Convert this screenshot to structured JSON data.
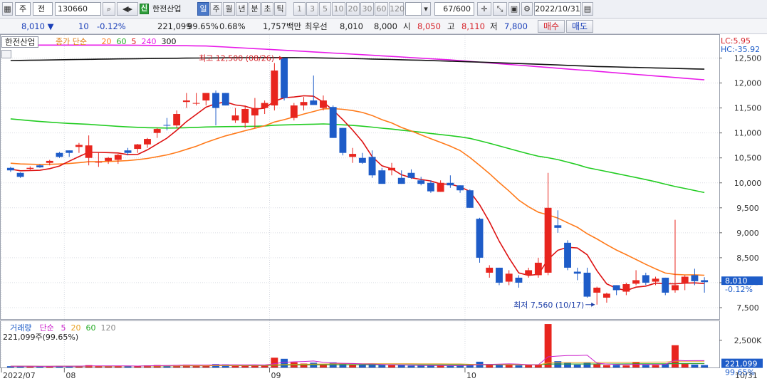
{
  "toolbar": {
    "market": "주",
    "period_select": "전",
    "code": "130660",
    "company": "한전산업",
    "periods": [
      "일",
      "주",
      "월",
      "년",
      "분",
      "초",
      "틱"
    ],
    "active_period": "일",
    "intervals": [
      "1",
      "3",
      "5",
      "10",
      "20",
      "30",
      "60",
      "120"
    ],
    "count": "67/600",
    "date": "2022/10/31"
  },
  "quote": {
    "price": "8,010",
    "change": "10",
    "change_pct": "-0.12%",
    "volume": "221,099",
    "vol_ratio": "99.65%",
    "turnover": "0.68%",
    "amount": "1,757백만",
    "best_label": "최우선",
    "best_ask": "8,010",
    "best_bid": "8,000",
    "open_label": "시",
    "open": "8,050",
    "high_label": "고",
    "high": "8,110",
    "low_label": "저",
    "low": "7,800",
    "buy": "매수",
    "sell": "매도"
  },
  "legend": {
    "name": "한전산업",
    "ma_label": "종가 단순",
    "ma20": "20",
    "ma60": "60",
    "ma5": "5",
    "ma240": "240",
    "ma300": "300",
    "vol_label": "거래량",
    "vol_ma_label": "단순",
    "vol_ma5": "5",
    "vol_ma20": "20",
    "vol_ma60": "60",
    "vol_ma120": "120",
    "vol_value": "221,099주(99.65%)"
  },
  "annotations": {
    "high": "최고 12,500 (08/26)",
    "low": "최저 7,560 (10/17)",
    "lc": "LC:5.95",
    "hc": "HC:-35.92"
  },
  "chart_data": {
    "type": "candlestick",
    "price_ticks": [
      "7,500",
      "8,000",
      "8,500",
      "9,000",
      "9,500",
      "10,000",
      "10,500",
      "11,000",
      "11,500",
      "12,000",
      "12,500"
    ],
    "price_tick_values": [
      7500,
      8000,
      8500,
      9000,
      9500,
      10000,
      10500,
      11000,
      11500,
      12000,
      12500
    ],
    "price_ylim": [
      7300,
      12750
    ],
    "current_price": "8,010",
    "current_pct": "-0.12%",
    "vol_ticks": [
      "2,500K"
    ],
    "vol_tick_values": [
      2500
    ],
    "vol_current": "221,099",
    "vol_current_pct": "99.65%",
    "vol_ylim": [
      0,
      4200
    ],
    "x_labels": [
      "2022/07",
      "08",
      "09",
      "10"
    ],
    "x_label_index": [
      0,
      6,
      27,
      47
    ],
    "end_label": "10/31",
    "candles": [
      {
        "o": 10300,
        "h": 10320,
        "l": 10220,
        "c": 10250,
        "v": 120
      },
      {
        "o": 10200,
        "h": 10210,
        "l": 10100,
        "c": 10120,
        "v": 110
      },
      {
        "o": 10280,
        "h": 10330,
        "l": 10240,
        "c": 10300,
        "v": 100
      },
      {
        "o": 10350,
        "h": 10370,
        "l": 10300,
        "c": 10310,
        "v": 95
      },
      {
        "o": 10400,
        "h": 10460,
        "l": 10350,
        "c": 10440,
        "v": 110
      },
      {
        "o": 10600,
        "h": 10620,
        "l": 10500,
        "c": 10520,
        "v": 140
      },
      {
        "o": 10650,
        "h": 10650,
        "l": 10520,
        "c": 10600,
        "v": 130
      },
      {
        "o": 10720,
        "h": 10800,
        "l": 10600,
        "c": 10760,
        "v": 150
      },
      {
        "o": 10500,
        "h": 10950,
        "l": 10350,
        "c": 10750,
        "v": 210
      },
      {
        "o": 10420,
        "h": 10600,
        "l": 10320,
        "c": 10420,
        "v": 130
      },
      {
        "o": 10440,
        "h": 10520,
        "l": 10380,
        "c": 10500,
        "v": 100
      },
      {
        "o": 10460,
        "h": 10580,
        "l": 10380,
        "c": 10560,
        "v": 160
      },
      {
        "o": 10650,
        "h": 10700,
        "l": 10550,
        "c": 10600,
        "v": 130
      },
      {
        "o": 10680,
        "h": 10780,
        "l": 10600,
        "c": 10770,
        "v": 150
      },
      {
        "o": 10770,
        "h": 10900,
        "l": 10700,
        "c": 10880,
        "v": 190
      },
      {
        "o": 11000,
        "h": 11100,
        "l": 10900,
        "c": 11080,
        "v": 220
      },
      {
        "o": 11160,
        "h": 11300,
        "l": 11050,
        "c": 11150,
        "v": 200
      },
      {
        "o": 11150,
        "h": 11450,
        "l": 11100,
        "c": 11380,
        "v": 230
      },
      {
        "o": 11620,
        "h": 11800,
        "l": 11500,
        "c": 11650,
        "v": 260
      },
      {
        "o": 11600,
        "h": 11800,
        "l": 11550,
        "c": 11600,
        "v": 220
      },
      {
        "o": 11650,
        "h": 11750,
        "l": 11550,
        "c": 11800,
        "v": 190
      },
      {
        "o": 11800,
        "h": 11850,
        "l": 11150,
        "c": 11500,
        "v": 310
      },
      {
        "o": 11800,
        "h": 11800,
        "l": 11550,
        "c": 11550,
        "v": 280
      },
      {
        "o": 11250,
        "h": 11500,
        "l": 11200,
        "c": 11350,
        "v": 200
      },
      {
        "o": 11200,
        "h": 11550,
        "l": 11100,
        "c": 11480,
        "v": 210
      },
      {
        "o": 11350,
        "h": 11700,
        "l": 11100,
        "c": 11500,
        "v": 240
      },
      {
        "o": 11500,
        "h": 11650,
        "l": 11380,
        "c": 11600,
        "v": 220
      },
      {
        "o": 11550,
        "h": 12400,
        "l": 11450,
        "c": 12250,
        "v": 900
      },
      {
        "o": 12500,
        "h": 12500,
        "l": 11650,
        "c": 11700,
        "v": 800
      },
      {
        "o": 11300,
        "h": 11600,
        "l": 11250,
        "c": 11550,
        "v": 480
      },
      {
        "o": 11550,
        "h": 11720,
        "l": 11450,
        "c": 11620,
        "v": 360
      },
      {
        "o": 11650,
        "h": 12150,
        "l": 11600,
        "c": 11560,
        "v": 440
      },
      {
        "o": 11500,
        "h": 11750,
        "l": 11450,
        "c": 11650,
        "v": 300
      },
      {
        "o": 11520,
        "h": 11550,
        "l": 10900,
        "c": 10900,
        "v": 470
      },
      {
        "o": 11100,
        "h": 11100,
        "l": 10550,
        "c": 10600,
        "v": 380
      },
      {
        "o": 10520,
        "h": 10700,
        "l": 10400,
        "c": 10580,
        "v": 240
      },
      {
        "o": 10500,
        "h": 10600,
        "l": 10380,
        "c": 10400,
        "v": 250
      },
      {
        "o": 10520,
        "h": 10650,
        "l": 10100,
        "c": 10150,
        "v": 280
      },
      {
        "o": 10250,
        "h": 10300,
        "l": 9980,
        "c": 9980,
        "v": 220
      },
      {
        "o": 10250,
        "h": 10400,
        "l": 10150,
        "c": 10300,
        "v": 210
      },
      {
        "o": 10100,
        "h": 10250,
        "l": 9980,
        "c": 9980,
        "v": 200
      },
      {
        "o": 10200,
        "h": 10270,
        "l": 10080,
        "c": 10100,
        "v": 170
      },
      {
        "o": 10050,
        "h": 10120,
        "l": 9950,
        "c": 9980,
        "v": 160
      },
      {
        "o": 10000,
        "h": 10050,
        "l": 9800,
        "c": 9830,
        "v": 180
      },
      {
        "o": 9820,
        "h": 10050,
        "l": 9820,
        "c": 10000,
        "v": 190
      },
      {
        "o": 10000,
        "h": 10150,
        "l": 9900,
        "c": 9950,
        "v": 150
      },
      {
        "o": 9950,
        "h": 9950,
        "l": 9800,
        "c": 9850,
        "v": 170
      },
      {
        "o": 9850,
        "h": 9870,
        "l": 9500,
        "c": 9500,
        "v": 280
      },
      {
        "o": 9280,
        "h": 9300,
        "l": 8400,
        "c": 8500,
        "v": 530
      },
      {
        "o": 8200,
        "h": 8350,
        "l": 8100,
        "c": 8300,
        "v": 320
      },
      {
        "o": 8300,
        "h": 8300,
        "l": 7950,
        "c": 8000,
        "v": 290
      },
      {
        "o": 8020,
        "h": 8250,
        "l": 7950,
        "c": 8180,
        "v": 250
      },
      {
        "o": 8100,
        "h": 8150,
        "l": 7900,
        "c": 8000,
        "v": 190
      },
      {
        "o": 8150,
        "h": 8300,
        "l": 8100,
        "c": 8250,
        "v": 230
      },
      {
        "o": 8150,
        "h": 8500,
        "l": 8100,
        "c": 8400,
        "v": 260
      },
      {
        "o": 8200,
        "h": 10200,
        "l": 8150,
        "c": 9500,
        "v": 4000
      },
      {
        "o": 9150,
        "h": 9450,
        "l": 9000,
        "c": 9100,
        "v": 580
      },
      {
        "o": 8800,
        "h": 8850,
        "l": 8250,
        "c": 8300,
        "v": 420
      },
      {
        "o": 8220,
        "h": 8300,
        "l": 8050,
        "c": 8180,
        "v": 260
      },
      {
        "o": 8200,
        "h": 8300,
        "l": 7700,
        "c": 7720,
        "v": 420
      },
      {
        "o": 7800,
        "h": 7920,
        "l": 7560,
        "c": 7900,
        "v": 290
      },
      {
        "o": 7700,
        "h": 7800,
        "l": 7600,
        "c": 7780,
        "v": 220
      },
      {
        "o": 7950,
        "h": 7950,
        "l": 7750,
        "c": 7850,
        "v": 230
      },
      {
        "o": 7820,
        "h": 8000,
        "l": 7750,
        "c": 7970,
        "v": 190
      },
      {
        "o": 7980,
        "h": 8250,
        "l": 7950,
        "c": 8050,
        "v": 520
      },
      {
        "o": 8150,
        "h": 8200,
        "l": 7950,
        "c": 8000,
        "v": 230
      },
      {
        "o": 8020,
        "h": 8120,
        "l": 7950,
        "c": 8080,
        "v": 220
      },
      {
        "o": 8100,
        "h": 8100,
        "l": 7750,
        "c": 7800,
        "v": 300
      },
      {
        "o": 7850,
        "h": 9260,
        "l": 7800,
        "c": 7950,
        "v": 2050
      },
      {
        "o": 8000,
        "h": 8150,
        "l": 7850,
        "c": 8120,
        "v": 330
      },
      {
        "o": 8150,
        "h": 8280,
        "l": 7950,
        "c": 8030,
        "v": 260
      },
      {
        "o": 8050,
        "h": 8110,
        "l": 7800,
        "c": 8010,
        "v": 221
      }
    ]
  }
}
